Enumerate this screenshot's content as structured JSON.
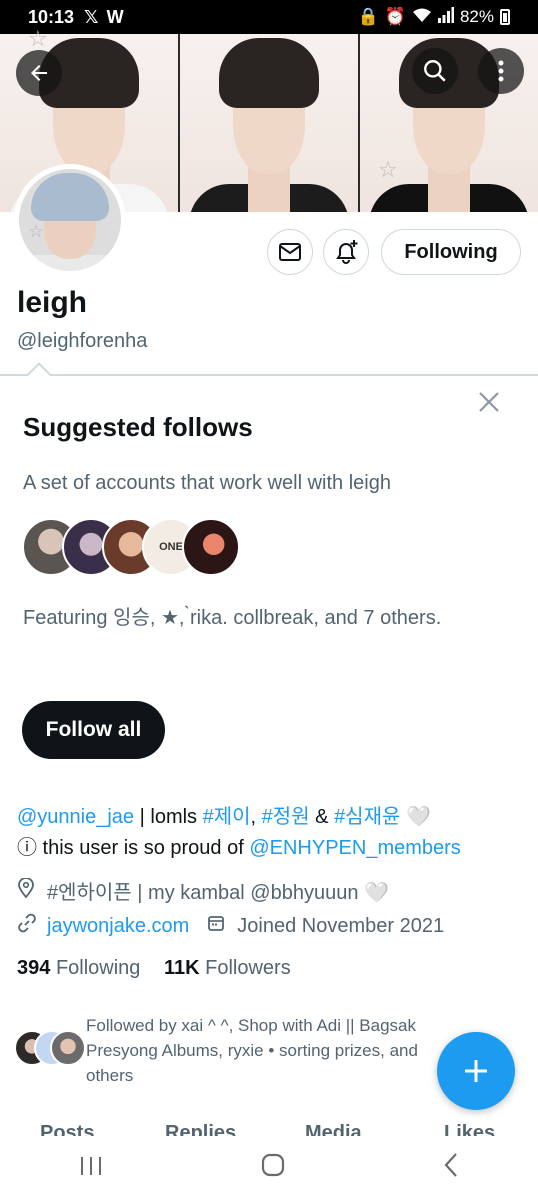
{
  "status_bar": {
    "time": "10:13",
    "icons": [
      "x-logo-icon",
      "w-app-icon"
    ],
    "right_icons": [
      "lock-icon",
      "alarm-icon",
      "wifi-icon",
      "signal-icon"
    ],
    "battery": "82%"
  },
  "header": {
    "back_icon": "arrow-left-icon",
    "search_icon": "search-icon",
    "more_icon": "more-vertical-icon"
  },
  "profile": {
    "display_name": "leigh",
    "handle": "@leighforenha",
    "following_button": "Following"
  },
  "suggested": {
    "title": "Suggested follows",
    "description": "A set of accounts that work well with leigh",
    "avatar4_text": "ONE",
    "featuring": "Featuring 잉승, ★, ̀rika. collbreak, and 7 others.",
    "follow_all": "Follow all"
  },
  "bio": {
    "line1": {
      "mention": "@yunnie_jae",
      "text1": " | lomls ",
      "tag1": "#제이",
      "sep1": ", ",
      "tag2": "#정원",
      "sep2": " & ",
      "tag3": "#심재윤",
      "heart": " 🤍"
    },
    "line2": {
      "info_icon": "ⓘ",
      "text": " this user is so proud of ",
      "mention": "@ENHYPEN_members"
    }
  },
  "meta": {
    "location": "#엔하이픈 | my kambal @bbhyuuun 🤍",
    "website": "jaywonjake.com",
    "joined": "Joined November 2021"
  },
  "stats": {
    "following_count": "394",
    "following_label": "Following",
    "followers_count": "11K",
    "followers_label": "Followers"
  },
  "followed_by": "Followed by xai ^ ^, Shop with Adi || Bagsak Presyong Albums, ryxie • sorting prizes, and others",
  "tabs": [
    "Posts",
    "Replies",
    "Media",
    "Likes"
  ],
  "colors": {
    "accent": "#1d9bf0",
    "text_primary": "#0f1419",
    "text_secondary": "#536471",
    "border": "#cfd9de"
  }
}
